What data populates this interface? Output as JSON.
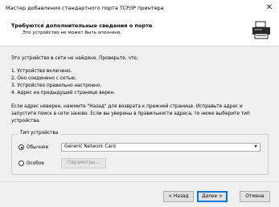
{
  "window": {
    "title": "Мастер добавления стандартного порта TCP/IP принтера",
    "close_glyph": "✕"
  },
  "header": {
    "title": "Требуются дополнительные сведения о порте",
    "subtitle": "Это устройство не может быть опознано."
  },
  "content": {
    "intro": "Это устройство в сети не найдено. Проверьте, что:",
    "checklist": [
      "1.  Устройство включено.",
      "2.  Оно соединено с сетью.",
      "3.  Устройство правильно настроено.",
      "4.  Адрес на предыдущей странице верен."
    ],
    "note": "Если адрес неверен, нажмите \"Назад\" для возврата к прежней странице. Исправьте адрес и запустите поиск в сети заново.  Если вы уверены в правильности адреса, то ниже выберите тип устройства."
  },
  "device_type": {
    "legend": "Тип устройства",
    "standard_label": "Обычное",
    "standard_value": "Generic Network Card",
    "custom_label": "Особое",
    "params_button": "Параметры..."
  },
  "footer": {
    "back": "< Назад",
    "next": "Далее >",
    "cancel": "Отмена"
  }
}
